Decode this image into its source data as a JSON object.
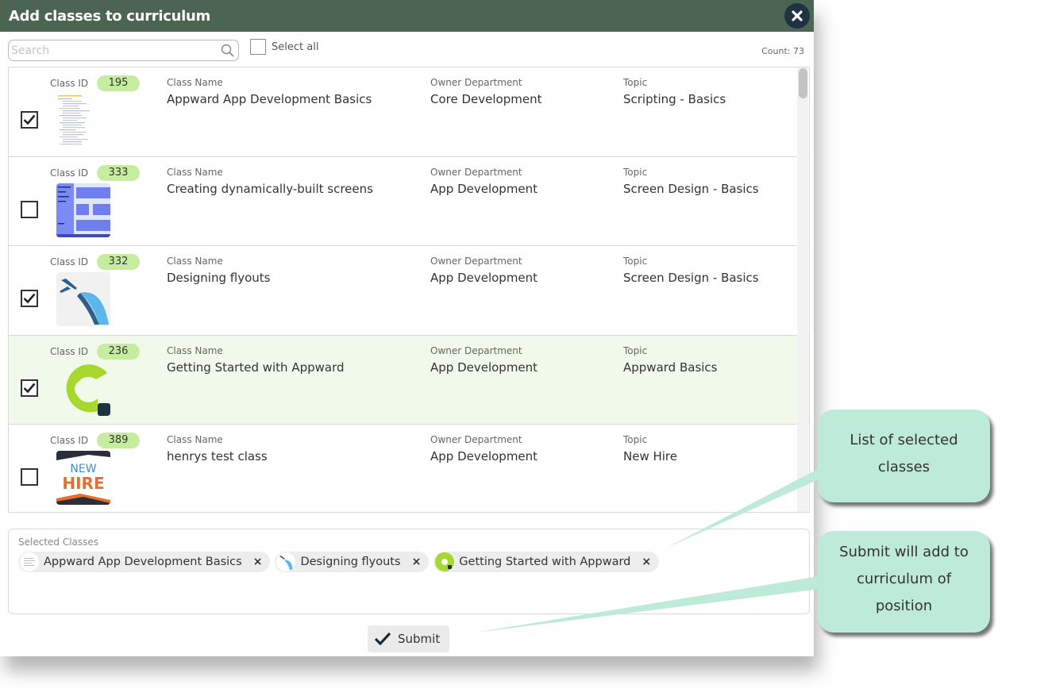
{
  "dialog": {
    "title": "Add classes to curriculum"
  },
  "toolbar": {
    "search_placeholder": "Search",
    "select_all_label": "Select all",
    "count_label": "Count: 73"
  },
  "columns": {
    "class_id": "Class ID",
    "class_name": "Class Name",
    "owner_department": "Owner Department",
    "topic": "Topic"
  },
  "rows": [
    {
      "id": "195",
      "name": "Appward App Development Basics",
      "department": "Core Development",
      "topic": "Scripting - Basics",
      "checked": true,
      "thumb": "code-screenshot-thumbnail"
    },
    {
      "id": "333",
      "name": "Creating dynamically-built screens",
      "department": "App Development",
      "topic": "Screen Design - Basics",
      "checked": false,
      "thumb": "screen-layout-thumbnail"
    },
    {
      "id": "332",
      "name": "Designing flyouts",
      "department": "App Development",
      "topic": "Screen Design - Basics",
      "checked": true,
      "thumb": "airplane-thumbnail"
    },
    {
      "id": "236",
      "name": "Getting Started with Appward",
      "department": "App Development",
      "topic": "Appward Basics",
      "checked": true,
      "thumb": "appward-logo-thumbnail"
    },
    {
      "id": "389",
      "name": "henrys test class",
      "department": "App Development",
      "topic": "New Hire",
      "checked": false,
      "thumb": "new-hire-thumbnail",
      "thumb_text": [
        "NEW",
        "HIRE"
      ]
    }
  ],
  "selected_panel": {
    "title": "Selected Classes",
    "chips": [
      {
        "label": "Appward App Development Basics",
        "remove": "×"
      },
      {
        "label": "Designing flyouts",
        "remove": "×"
      },
      {
        "label": "Getting Started with Appward",
        "remove": "×"
      }
    ]
  },
  "submit": {
    "label": "Submit"
  },
  "callouts": [
    {
      "lines": [
        "List of selected",
        "classes"
      ]
    },
    {
      "lines": [
        "Submit will add to",
        "curriculum of",
        "position"
      ]
    }
  ],
  "colors": {
    "titlebar": "#4b6552",
    "id_pill": "#c6ec9f",
    "selected_row": "#f1f9ea",
    "callout": "#bdebd8",
    "appward_green": "#a6d82d"
  }
}
